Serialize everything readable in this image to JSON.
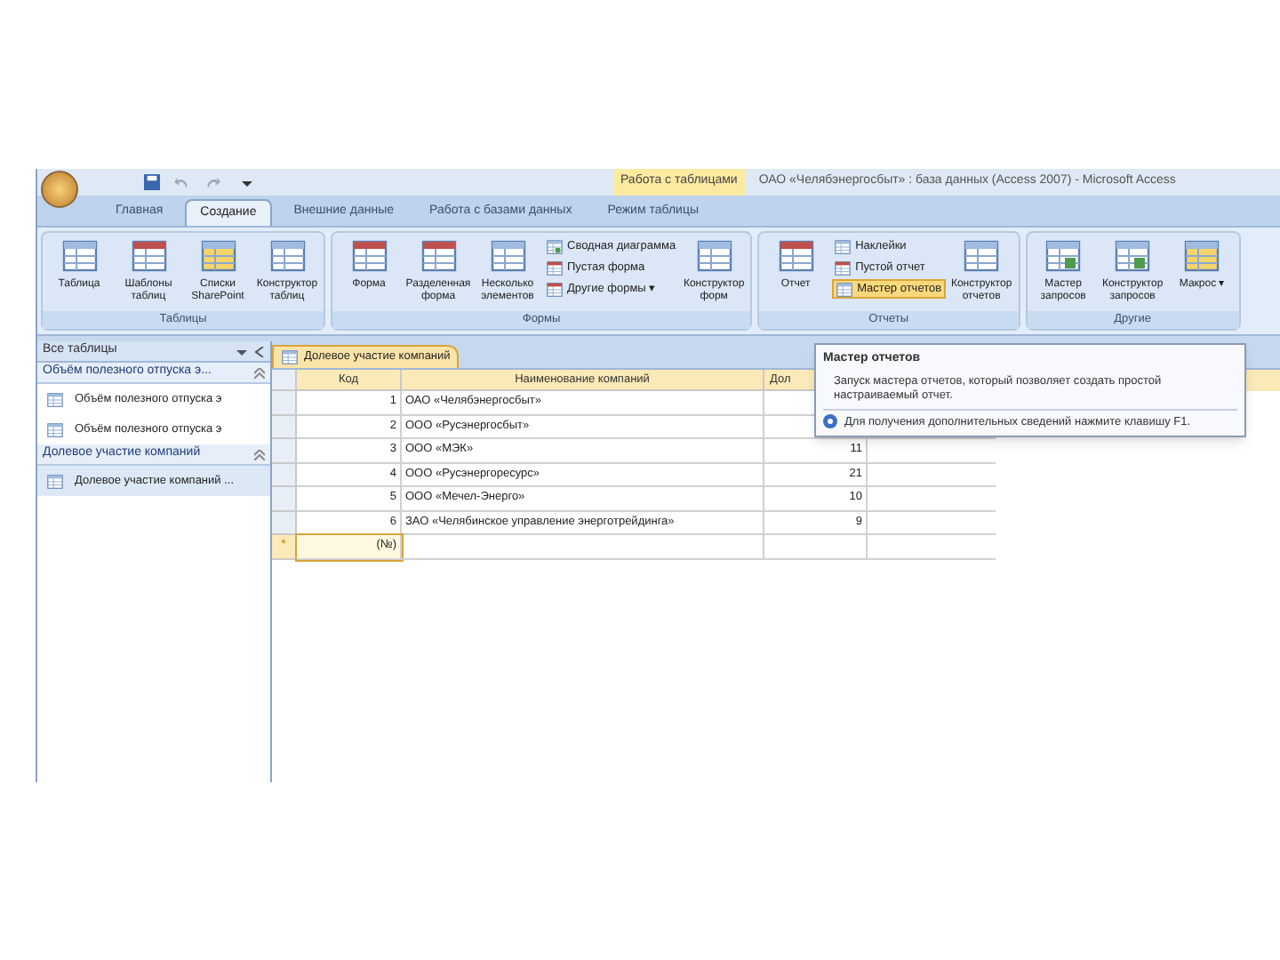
{
  "window": {
    "title": "ОАО «Челябэнергосбыт» : база данных (Access 2007) - Microsoft Access",
    "context_tab": "Работа с таблицами"
  },
  "tabs": [
    {
      "label": "Главная",
      "selected": false
    },
    {
      "label": "Создание",
      "selected": true
    },
    {
      "label": "Внешние данные",
      "selected": false
    },
    {
      "label": "Работа с базами данных",
      "selected": false
    },
    {
      "label": "Режим таблицы",
      "selected": false
    }
  ],
  "ribbon": [
    {
      "label": "Таблицы",
      "items": [
        {
          "kind": "large",
          "label": "Таблица",
          "highlighted": false
        },
        {
          "kind": "large",
          "label": "Шаблоны таблиц",
          "highlighted": false
        },
        {
          "kind": "large",
          "label": "Списки SharePoint",
          "highlighted": false
        },
        {
          "kind": "large",
          "label": "Конструктор таблиц",
          "highlighted": false
        }
      ]
    },
    {
      "label": "Формы",
      "items": [
        {
          "kind": "large",
          "label": "Форма",
          "highlighted": false
        },
        {
          "kind": "large",
          "label": "Разделенная форма",
          "highlighted": false
        },
        {
          "kind": "large",
          "label": "Несколько элементов",
          "highlighted": false
        },
        {
          "kind": "small",
          "label": "Сводная диаграмма",
          "highlighted": false
        },
        {
          "kind": "small",
          "label": "Пустая форма",
          "highlighted": false
        },
        {
          "kind": "small",
          "label": "Другие формы ▾",
          "highlighted": false
        },
        {
          "kind": "large",
          "label": "Конструктор форм",
          "highlighted": false
        }
      ]
    },
    {
      "label": "Отчеты",
      "items": [
        {
          "kind": "large",
          "label": "Отчет",
          "highlighted": false
        },
        {
          "kind": "small",
          "label": "Наклейки",
          "highlighted": false
        },
        {
          "kind": "small",
          "label": "Пустой отчет",
          "highlighted": false
        },
        {
          "kind": "small",
          "label": "Мастер отчетов",
          "highlighted": true
        },
        {
          "kind": "large",
          "label": "Конструктор отчетов",
          "highlighted": false
        }
      ]
    },
    {
      "label": "Другие",
      "items": [
        {
          "kind": "large",
          "label": "Мастер запросов",
          "highlighted": false
        },
        {
          "kind": "large",
          "label": "Конструктор запросов",
          "highlighted": false
        },
        {
          "kind": "large",
          "label": "Макрос ▾",
          "highlighted": false
        }
      ]
    }
  ],
  "navigation": {
    "title": "Все таблицы",
    "groups": [
      {
        "label": "Объём полезного отпуска э...",
        "items": [
          "Объём полезного отпуска э",
          "Объём полезного отпуска э"
        ]
      },
      {
        "label": "Долевое участие компаний",
        "items": [
          "Долевое участие компаний ..."
        ]
      }
    ]
  },
  "document_tab": "Долевое участие компаний",
  "table": {
    "columns": [
      "Код",
      "Наименование компаний",
      "Дол"
    ],
    "rows": [
      [
        "1",
        "ОАО «Челябэнергосбыт»"
      ],
      [
        "2",
        "ООО «Русэнергосбыт»"
      ],
      [
        "3",
        "ООО «МЭК»",
        "11"
      ],
      [
        "4",
        "ООО «Русэнергоресурс»",
        "21"
      ],
      [
        "5",
        "ООО «Мечел-Энерго»",
        "10"
      ],
      [
        "6",
        "ЗАО «Челябинское управление энерготрейдинга»",
        "9"
      ]
    ],
    "new_row": {
      "marker": "*",
      "value": "(№)"
    }
  },
  "tooltip": {
    "title": "Мастер отчетов",
    "body": "Запуск мастера отчетов, который позволяет создать простой настраиваемый отчет.",
    "help": "Для получения дополнительных сведений нажмите клавишу F1."
  }
}
